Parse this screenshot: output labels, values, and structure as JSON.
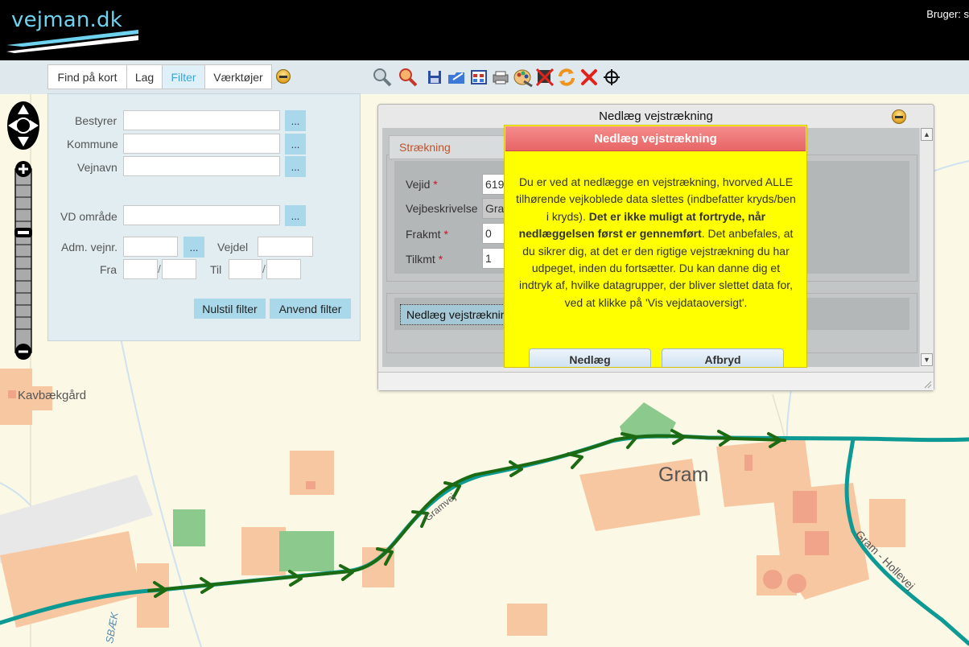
{
  "header": {
    "logo_text": "vejman.dk",
    "user_label": "Bruger: s"
  },
  "tabs": [
    {
      "label": "Find på kort",
      "active": false
    },
    {
      "label": "Lag",
      "active": false
    },
    {
      "label": "Filter",
      "active": true
    },
    {
      "label": "Værktøjer",
      "active": false
    }
  ],
  "toolbar_icons": [
    "zoom-out-icon",
    "zoom-in-icon",
    "save-icon",
    "export-icon",
    "grid-icon",
    "print-icon",
    "palette-icon",
    "remove-road-icon",
    "refresh-icon",
    "delete-icon",
    "crosshair-icon"
  ],
  "filter": {
    "bestyrer_label": "Bestyrer",
    "kommune_label": "Kommune",
    "vejnavn_label": "Vejnavn",
    "vd_omraade_label": "VD område",
    "adm_vejnr_label": "Adm. vejnr.",
    "vejdel_label": "Vejdel",
    "fra_label": "Fra",
    "til_label": "Til",
    "lookup_label": "...",
    "slash": "/",
    "reset_label": "Nulstil filter",
    "apply_label": "Anvend filter"
  },
  "dialog": {
    "title": "Nedlæg vejstrækning",
    "section_title": "Strækning",
    "vejid_label": "Vejid",
    "vejid_value": "619",
    "vejbeskrivelse_label": "Vejbeskrivelse",
    "vejbeskrivelse_value": "Gra",
    "frakmt_label": "Frakmt",
    "frakmt_value": "0",
    "tilkmt_label": "Tilkmt",
    "tilkmt_value": "1",
    "required_mark": "*",
    "action_label": "Nedlæg vejstrækning"
  },
  "confirm": {
    "title": "Nedlæg vejstrækning",
    "text_part1": "Du er ved at nedlægge en vejstrækning, hvorved ALLE tilhørende vejkoblede data slettes (indbefatter kryds/ben i kryds).",
    "text_bold": "Det er ikke muligt at fortryde, når nedlæggelsen først er gennemført",
    "text_part2": ". Det anbefales, at du sikrer dig, at det er den rigtige vejstrækning du har udpeget, inden du fortsætter. Du kan danne dig et indtryk af, hvilke datagrupper, der bliver slettet data for, ved at klikke på 'Vis vejdataoversigt'.",
    "confirm_label": "Nedlæg",
    "cancel_label": "Afbryd"
  },
  "map": {
    "place_gram": "Gram",
    "place_kavbaekgaard": "Kavbækgård",
    "road_gram_hollevej": "Gram - Hollevej",
    "road_sbaek": "SBÆK",
    "road_small": "Gramvej",
    "route_color": "#1c6b12",
    "road_color": "#0e9a94"
  }
}
